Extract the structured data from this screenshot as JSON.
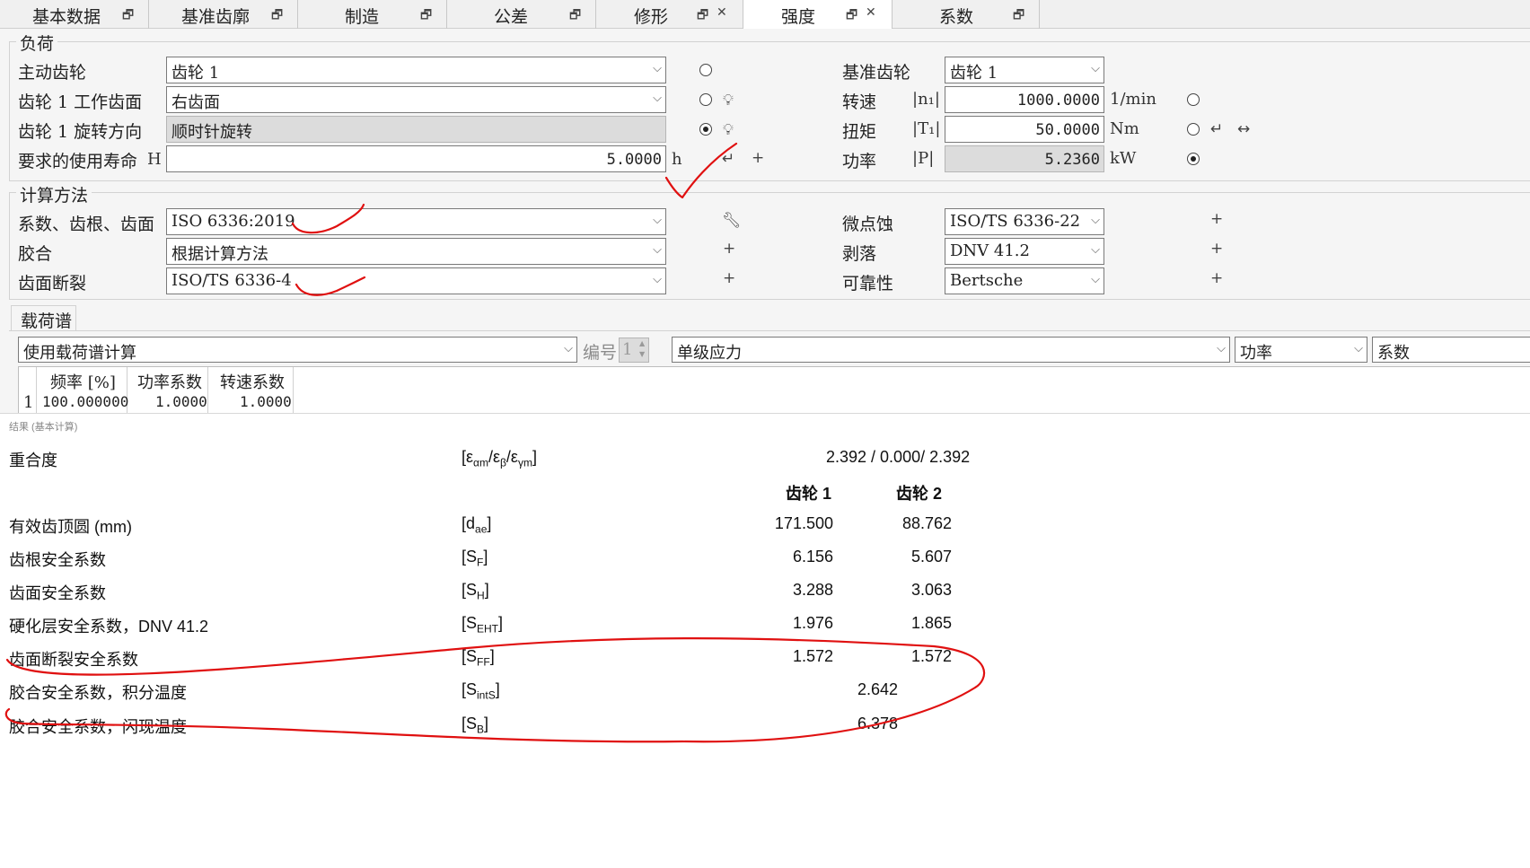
{
  "tabs": [
    {
      "label": "基本数据",
      "closable": false
    },
    {
      "label": "基准齿廓",
      "closable": false
    },
    {
      "label": "制造",
      "closable": false
    },
    {
      "label": "公差",
      "closable": false
    },
    {
      "label": "修形",
      "closable": true
    },
    {
      "label": "强度",
      "closable": true,
      "active": true
    },
    {
      "label": "系数",
      "closable": false
    }
  ],
  "load": {
    "title": "负荷",
    "drive_gear_label": "主动齿轮",
    "drive_gear_value": "齿轮  1",
    "work_flank_label": "齿轮  1  工作齿面",
    "work_flank_value": "右齿面",
    "rotation_label": "齿轮  1  旋转方向",
    "rotation_value": "顺时针旋转",
    "life_label": "要求的使用寿命",
    "life_symbol": "H",
    "life_value": "5.0000",
    "life_unit": "h",
    "ref_gear_label": "基准齿轮",
    "ref_gear_value": "齿轮  1",
    "speed_label": "转速",
    "speed_symbol": "n₁",
    "speed_value": "1000.0000",
    "speed_unit": "1/min",
    "torque_label": "扭矩",
    "torque_symbol": "T₁",
    "torque_value": "50.0000",
    "torque_unit": "Nm",
    "power_label": "功率",
    "power_symbol": "P",
    "power_value": "5.2360",
    "power_unit": "kW"
  },
  "method": {
    "title": "计算方法",
    "factors_label": "系数、齿根、齿面",
    "factors_value": "ISO 6336:2019",
    "scuffing_label": "胶合",
    "scuffing_value": "根据计算方法",
    "flank_fracture_label": "齿面断裂",
    "flank_fracture_value": "ISO/TS  6336-4",
    "micropitting_label": "微点蚀",
    "micropitting_value": "ISO/TS  6336-22",
    "spalling_label": "剥落",
    "spalling_value": "DNV 41.2",
    "reliability_label": "可靠性",
    "reliability_value": "Bertsche"
  },
  "spectrum": {
    "tab_label": "载荷谱",
    "mode_value": "使用载荷谱计算",
    "number_label": "编号",
    "number_value": "1",
    "stress_value": "单级应力",
    "power_value": "功率",
    "factor_value": "系数",
    "columns": [
      "频率 [%]",
      "功率系数",
      "转速系数"
    ],
    "rows": [
      [
        "1",
        "100.000000",
        "1.0000",
        "1.0000"
      ]
    ]
  },
  "results": {
    "caption": "结果 (基本计算)",
    "contact_ratio": {
      "label": "重合度",
      "value": "2.392 /  0.000/ 2.392"
    },
    "col_gear1": "齿轮 1",
    "col_gear2": "齿轮 2",
    "rows": [
      {
        "label": "有效齿顶圆 (mm)",
        "v1": "171.500",
        "v2": "88.762"
      },
      {
        "label": "齿根安全系数",
        "v1": "6.156",
        "v2": "5.607"
      },
      {
        "label": "齿面安全系数",
        "v1": "3.288",
        "v2": "3.063"
      },
      {
        "label": "硬化层安全系数，DNV 41.2",
        "v1": "1.976",
        "v2": "1.865"
      },
      {
        "label": "齿面断裂安全系数",
        "v1": "1.572",
        "v2": "1.572"
      },
      {
        "label": "胶合安全系数，积分温度",
        "v": "2.642"
      },
      {
        "label": "胶合安全系数，闪现温度",
        "v": "6.378"
      }
    ]
  },
  "colors": {
    "annotation": "#e01010",
    "panel": "#f5f5f5",
    "border": "#7a7a7a"
  }
}
